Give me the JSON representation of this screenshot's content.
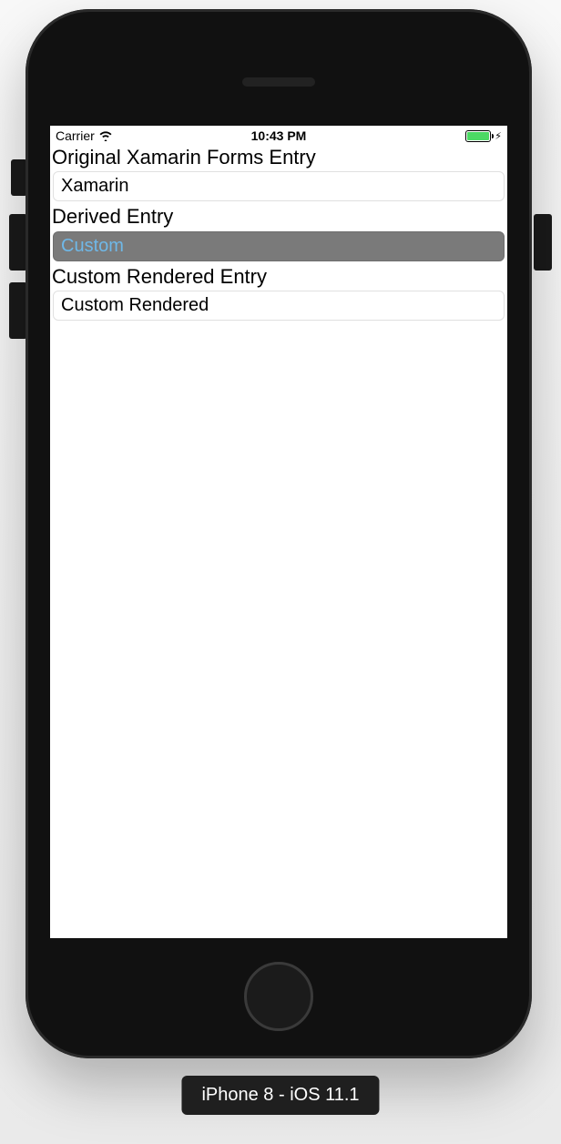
{
  "status_bar": {
    "carrier": "Carrier",
    "time": "10:43 PM"
  },
  "sections": {
    "original": {
      "label": "Original Xamarin Forms Entry",
      "value": "Xamarin"
    },
    "derived": {
      "label": "Derived Entry",
      "value": "Custom"
    },
    "rendered": {
      "label": "Custom Rendered Entry",
      "value": "Custom Rendered"
    }
  },
  "device_label": "iPhone 8 - iOS 11.1"
}
